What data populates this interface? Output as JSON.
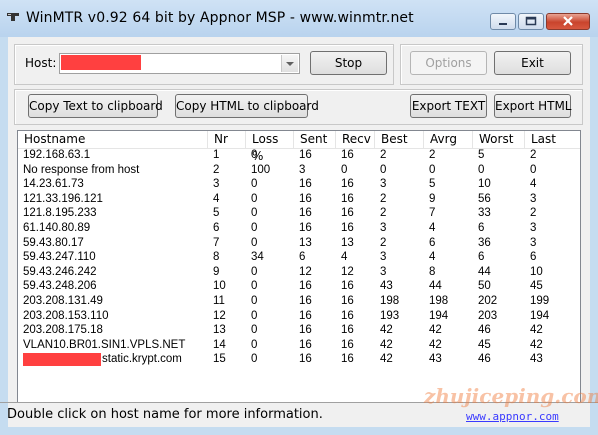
{
  "window": {
    "title": "WinMTR v0.92 64 bit by Appnor MSP - www.winmtr.net",
    "controls": [
      "minimize-icon",
      "maximize-icon",
      "close-icon"
    ]
  },
  "host": {
    "label": "Host:",
    "value": "",
    "stop_label": "Stop"
  },
  "side": {
    "options_label": "Options",
    "exit_label": "Exit"
  },
  "export": {
    "copy_text": "Copy Text to clipboard",
    "copy_html": "Copy HTML to clipboard",
    "export_text": "Export TEXT",
    "export_html": "Export HTML"
  },
  "table": {
    "columns": [
      "Hostname",
      "Nr",
      "Loss %",
      "Sent",
      "Recv",
      "Best",
      "Avrg",
      "Worst",
      "Last"
    ],
    "rows": [
      [
        "192.168.63.1",
        "1",
        "0",
        "16",
        "16",
        "2",
        "2",
        "5",
        "2"
      ],
      [
        "No response from host",
        "2",
        "100",
        "3",
        "0",
        "0",
        "0",
        "0",
        "0"
      ],
      [
        "14.23.61.73",
        "3",
        "0",
        "16",
        "16",
        "3",
        "5",
        "10",
        "4"
      ],
      [
        "121.33.196.121",
        "4",
        "0",
        "16",
        "16",
        "2",
        "9",
        "56",
        "3"
      ],
      [
        "121.8.195.233",
        "5",
        "0",
        "16",
        "16",
        "2",
        "7",
        "33",
        "2"
      ],
      [
        "61.140.80.89",
        "6",
        "0",
        "16",
        "16",
        "3",
        "4",
        "6",
        "3"
      ],
      [
        "59.43.80.17",
        "7",
        "0",
        "13",
        "13",
        "2",
        "6",
        "36",
        "3"
      ],
      [
        "59.43.247.110",
        "8",
        "34",
        "6",
        "4",
        "3",
        "4",
        "6",
        "6"
      ],
      [
        "59.43.246.242",
        "9",
        "0",
        "12",
        "12",
        "3",
        "8",
        "44",
        "10"
      ],
      [
        "59.43.248.206",
        "10",
        "0",
        "16",
        "16",
        "43",
        "44",
        "50",
        "45"
      ],
      [
        "203.208.131.49",
        "11",
        "0",
        "16",
        "16",
        "198",
        "198",
        "202",
        "199"
      ],
      [
        "203.208.153.110",
        "12",
        "0",
        "16",
        "16",
        "193",
        "194",
        "203",
        "194"
      ],
      [
        "203.208.175.18",
        "13",
        "0",
        "16",
        "16",
        "42",
        "42",
        "46",
        "42"
      ],
      [
        "VLAN10.BR01.SIN1.VPLS.NET",
        "14",
        "0",
        "16",
        "16",
        "42",
        "42",
        "45",
        "42"
      ],
      [
        "static.krypt.com",
        "15",
        "0",
        "16",
        "16",
        "42",
        "43",
        "46",
        "43"
      ]
    ]
  },
  "status": {
    "text": "Double click on host name for more information.",
    "link": "www.appnor.com"
  },
  "watermark": "zhujiceping.com",
  "colors": {
    "redaction": "#ff4040",
    "titlebar": "#c5dcf0",
    "link": "#3a3aff"
  }
}
